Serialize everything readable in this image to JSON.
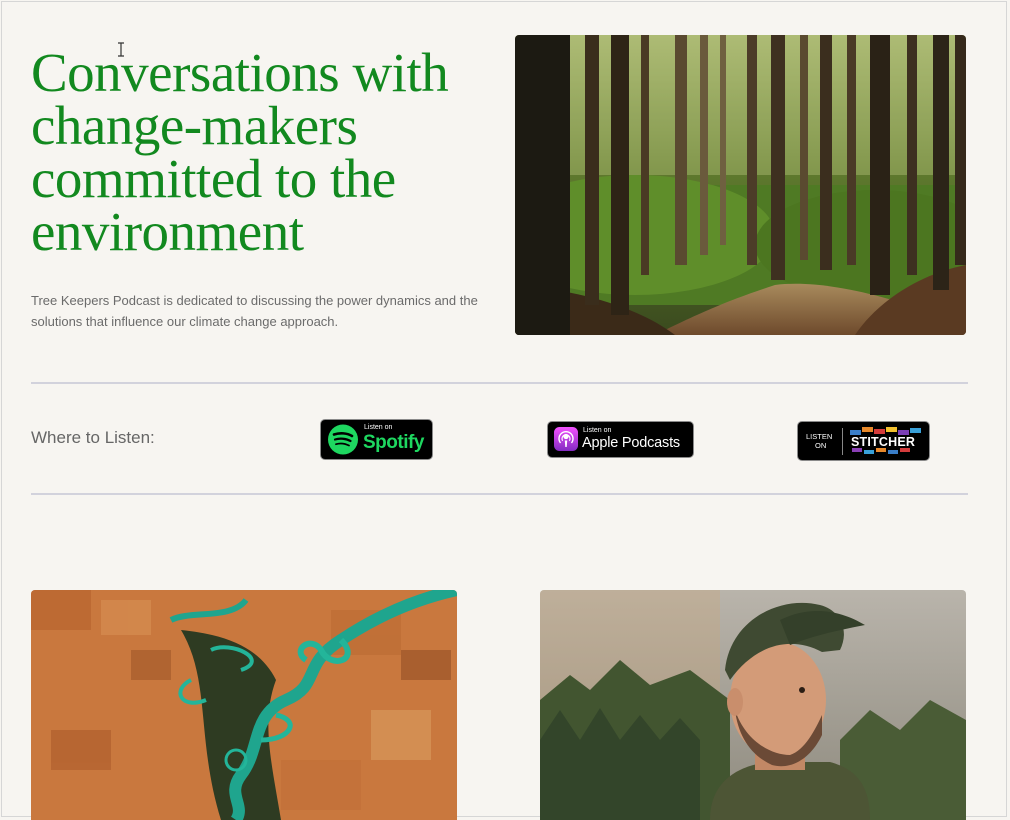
{
  "hero": {
    "title": "Conversations with change-makers committed to the environment",
    "description": "Tree Keepers Podcast is dedicated to discussing the power dynamics and the solutions that influence our climate change approach."
  },
  "listen": {
    "label": "Where to Listen:",
    "spotify": {
      "small": "Listen on",
      "big": "Spotify"
    },
    "apple": {
      "small": "Listen on",
      "big": "Apple Podcasts"
    },
    "stitcher": {
      "small_line1": "LISTEN",
      "small_line2": "ON",
      "big": "STITCHER"
    }
  },
  "colors": {
    "accent_green": "#12891f",
    "background": "#f7f5f1",
    "spotify_green": "#1ed760"
  }
}
